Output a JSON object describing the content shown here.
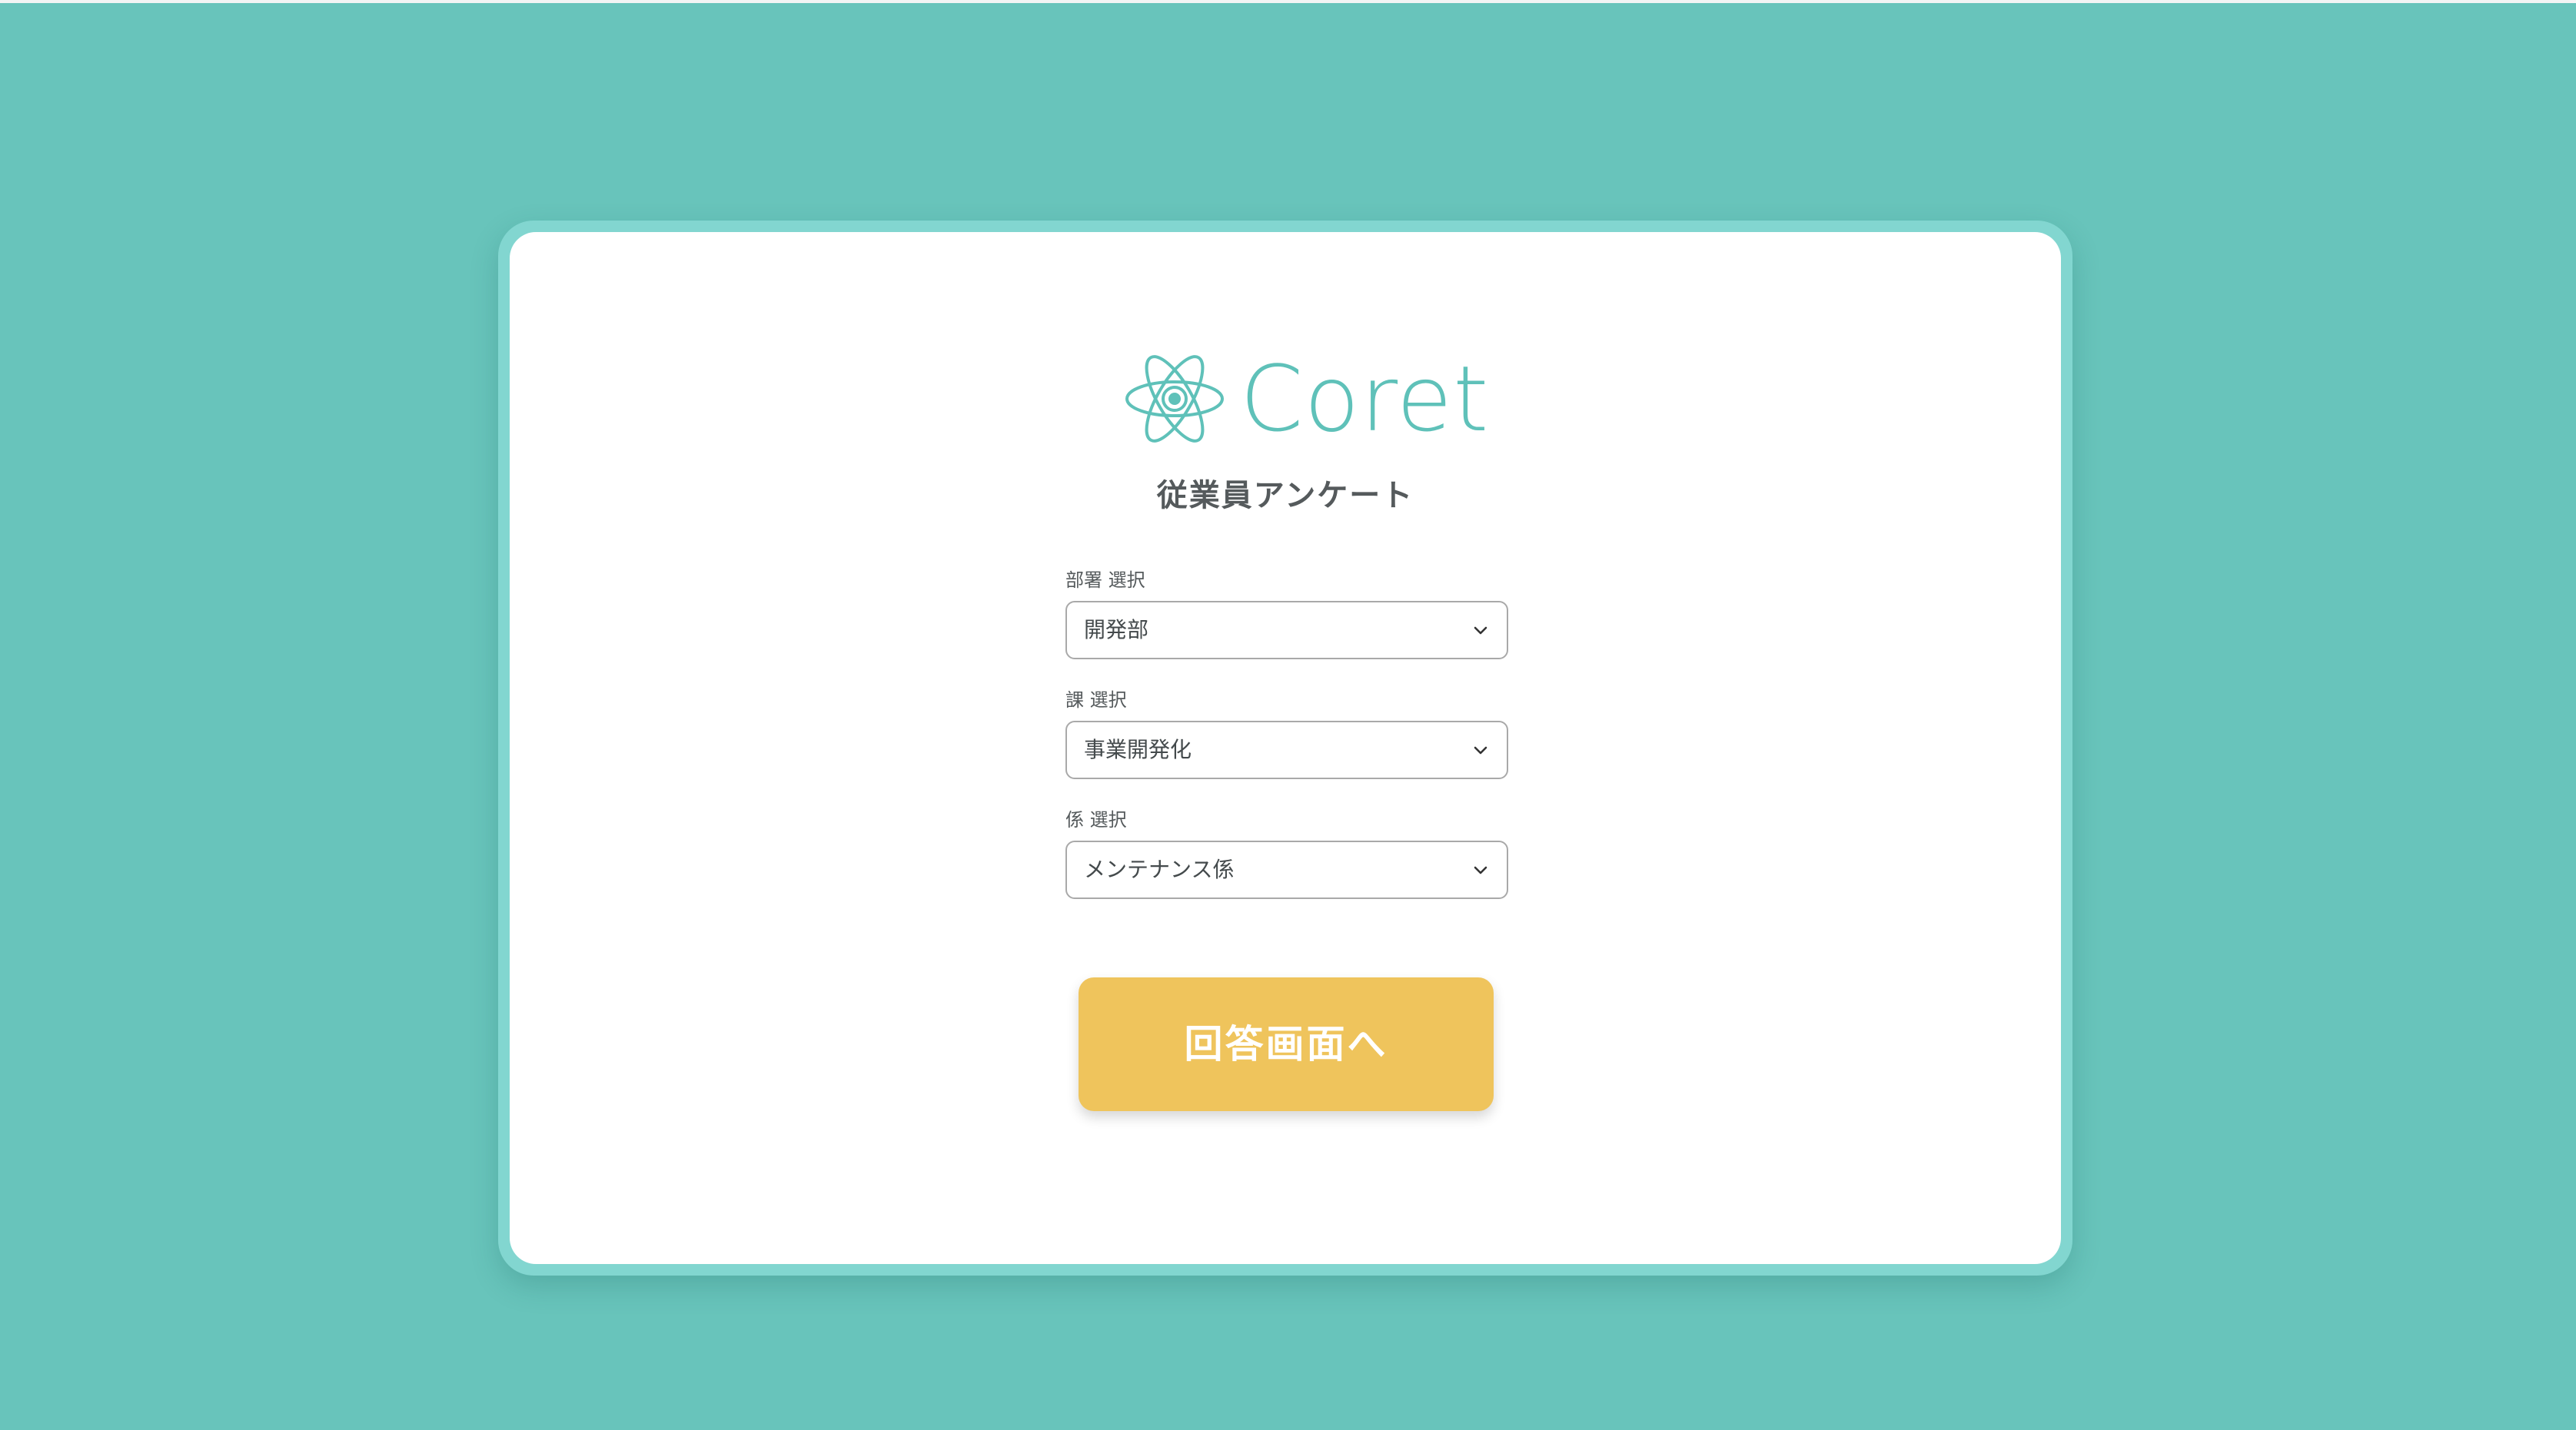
{
  "app": {
    "logo_text": "Coret",
    "survey_title": "従業員アンケート"
  },
  "form": {
    "department": {
      "label": "部署 選択",
      "value": "開発部"
    },
    "section": {
      "label": "課 選択",
      "value": "事業開発化"
    },
    "team": {
      "label": "係 選択",
      "value": "メンテナンス係"
    },
    "submit_label": "回答画面へ"
  },
  "colors": {
    "background": "#68c4bb",
    "card_border": "#82d6d0",
    "brand": "#5fc1b9",
    "button": "#efc45c"
  },
  "icons": {
    "logo_mark": "atom-icon",
    "select_indicator": "chevron-down-icon"
  }
}
